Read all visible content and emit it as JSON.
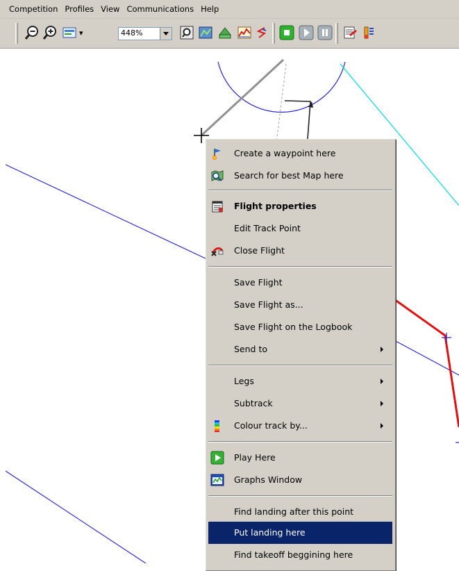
{
  "menubar": {
    "items": [
      "Competition",
      "Profiles",
      "View",
      "Communications",
      "Help"
    ]
  },
  "toolbar": {
    "zoom_value": "448%",
    "zoom_options": [
      "448%"
    ],
    "icons": [
      "zoom-out-icon",
      "zoom-in-icon",
      "map-layer-icon",
      "zoom-fit-icon",
      "map-tiles-icon",
      "airspace-icon",
      "altitude-graph-icon",
      "track-icon",
      "record-icon",
      "play-icon",
      "pause-icon",
      "flight-analysis-icon",
      "thermal-icon"
    ]
  },
  "context_menu": {
    "groups": [
      [
        {
          "label": "Create a waypoint here",
          "icon": "waypoint-flag-icon"
        },
        {
          "label": "Search for best Map here",
          "icon": "map-search-icon"
        }
      ],
      [
        {
          "label": "Flight properties",
          "icon": "flight-properties-icon",
          "bold": true
        },
        {
          "label": "Edit Track Point"
        },
        {
          "label": "Close Flight",
          "icon": "close-flight-icon"
        }
      ],
      [
        {
          "label": "Save Flight"
        },
        {
          "label": "Save Flight as..."
        },
        {
          "label": "Save Flight on the Logbook"
        },
        {
          "label": "Send to",
          "submenu": true
        }
      ],
      [
        {
          "label": "Legs",
          "submenu": true
        },
        {
          "label": "Subtrack",
          "submenu": true
        },
        {
          "label": "Colour track by...",
          "icon": "colour-bar-icon",
          "submenu": true
        }
      ],
      [
        {
          "label": "Play Here",
          "icon": "play-here-icon"
        },
        {
          "label": "Graphs Window",
          "icon": "graphs-window-icon"
        }
      ],
      [
        {
          "label": "Find landing after this point"
        },
        {
          "label": "Put landing here",
          "selected": true
        },
        {
          "label": "Find takeoff beggining here"
        }
      ]
    ]
  },
  "colors": {
    "menu_bg": "#d4d0c8",
    "selection": "#0a246a",
    "task_line": "#1818d8",
    "cyan_line": "#00d8e0",
    "red_track": "#e01010",
    "grey_track": "#909090"
  }
}
